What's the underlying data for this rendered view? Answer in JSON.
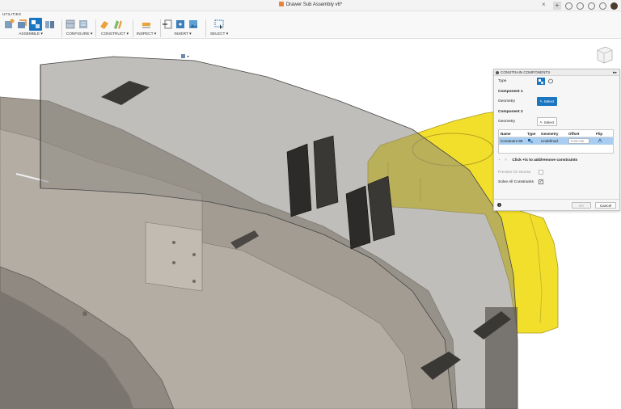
{
  "window": {
    "doc_title": "Drawer Sub Assembly v6*",
    "close_glyph": "×",
    "add_tab_glyph": "+"
  },
  "toolbar": {
    "tab": "UTILITIES",
    "groups": [
      {
        "label": "ASSEMBLE ▾"
      },
      {
        "label": "CONFIGURE ▾"
      },
      {
        "label": "CONSTRUCT ▾"
      },
      {
        "label": "INSPECT ▾"
      },
      {
        "label": "INSERT ▾"
      },
      {
        "label": "SELECT ▾"
      }
    ]
  },
  "dialog": {
    "title": "CONSTRAIN COMPONENTS",
    "type_label": "Type",
    "component1_label": "Component 1",
    "component2_label": "Component 2",
    "geometry_label": "Geometry",
    "select1": "Select",
    "select2": "Select",
    "table_headers": [
      "Name",
      "Type",
      "Geometry",
      "Offset",
      "Flip"
    ],
    "row": {
      "name": "Constraint 99",
      "geometry": "Undefined",
      "offset": "0.00 mm"
    },
    "add_remove": "Click +/x to add/remove constraints",
    "add_glyph": "+",
    "remove_glyph": "×",
    "preview_label": "Preview On Mouse",
    "solve_label": "Solve All Constraints",
    "solve_checked": true,
    "ok": "OK",
    "cancel": "Cancel",
    "info_glyph": "i"
  },
  "colors": {
    "accent": "#1b76c2",
    "selected_row": "#a8cdf0",
    "part_gray": "#9e978d",
    "part_yellow": "#f2df2c"
  }
}
